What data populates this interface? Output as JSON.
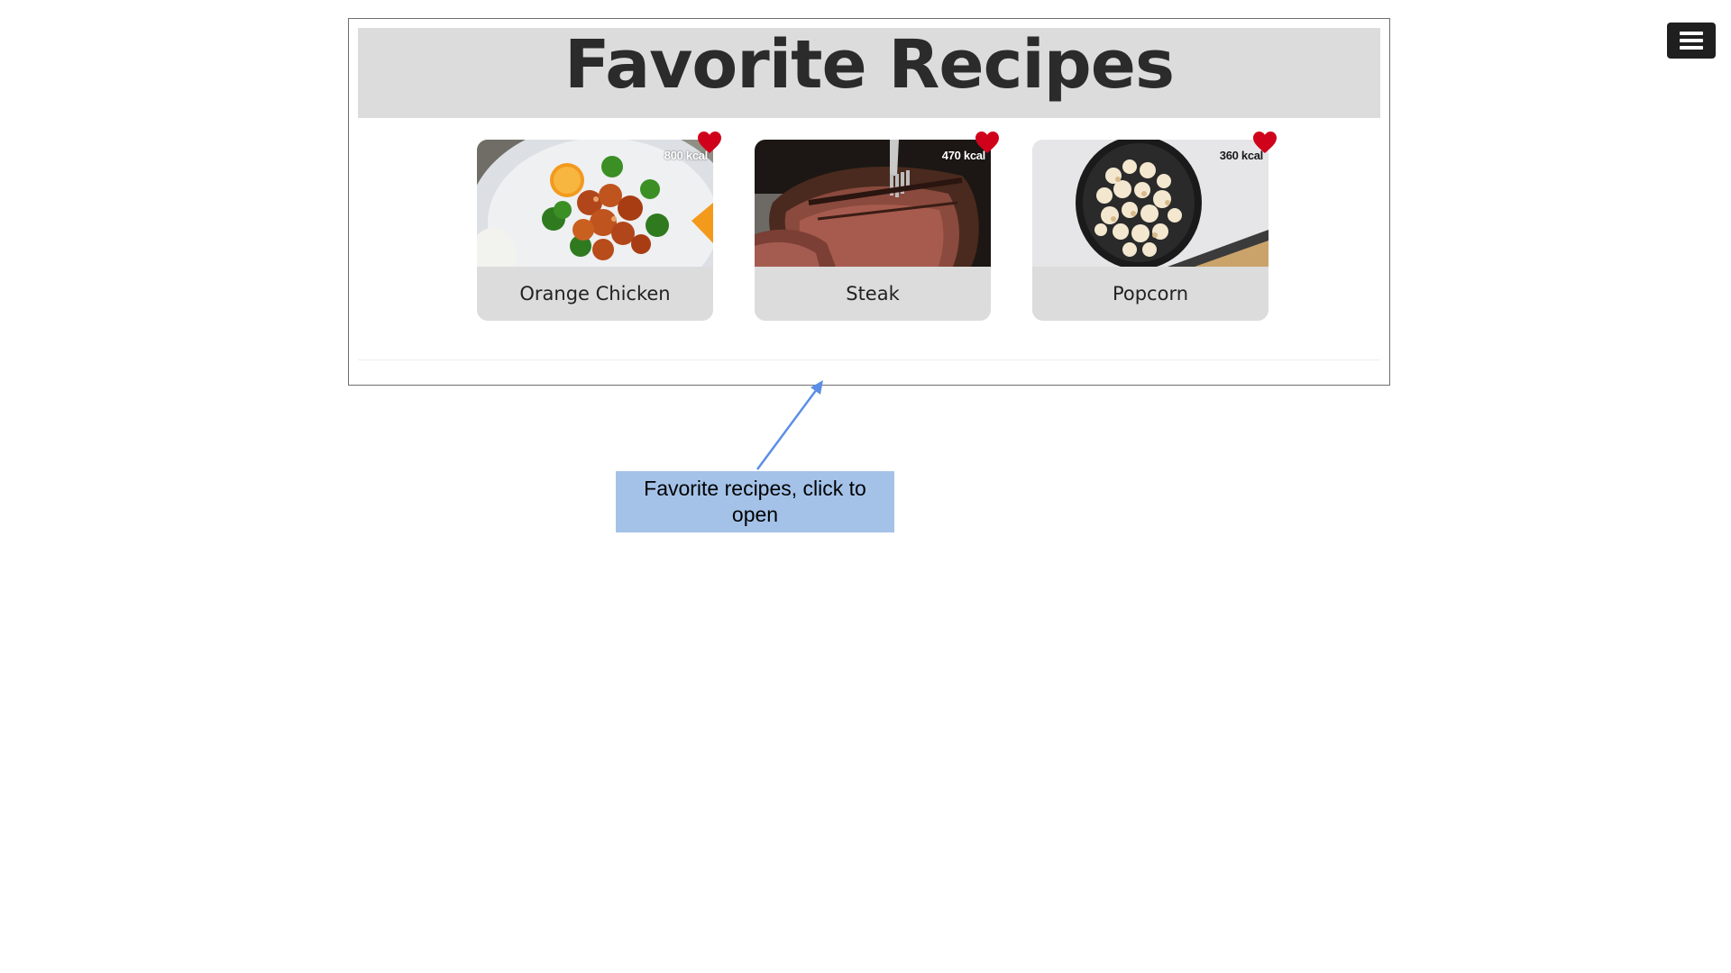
{
  "page": {
    "title": "Favorite Recipes"
  },
  "menu": {
    "icon": "hamburger-menu-icon"
  },
  "recipes": [
    {
      "name": "Orange Chicken",
      "calories": "800 kcal",
      "favorite": true,
      "favorite_icon": "heart-icon",
      "image": "orange-chicken-photo"
    },
    {
      "name": "Steak",
      "calories": "470 kcal",
      "favorite": true,
      "favorite_icon": "heart-icon",
      "image": "steak-photo"
    },
    {
      "name": "Popcorn",
      "calories": "360 kcal",
      "favorite": true,
      "favorite_icon": "heart-icon",
      "image": "popcorn-photo"
    }
  ],
  "annotation": {
    "text": "Favorite recipes, click to open"
  },
  "colors": {
    "heart": "#d0021b",
    "title_bar": "#dcdcdc",
    "card": "#dcdcdc",
    "callout": "#a4c2e8",
    "arrow": "#5b8ee6",
    "menu_button": "#1f1f1f"
  }
}
